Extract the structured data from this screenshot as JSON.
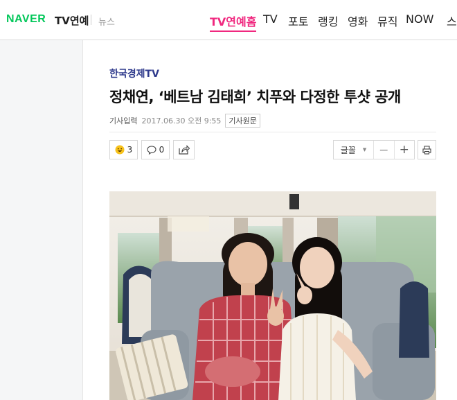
{
  "header": {
    "logo": "NAVER",
    "brand": "TV연예",
    "section": "뉴스",
    "nav": [
      {
        "label": "TV연예홈",
        "active": true
      },
      {
        "label": "TV",
        "active": false
      },
      {
        "label": "포토",
        "active": false
      },
      {
        "label": "랭킹",
        "active": false
      },
      {
        "label": "영화",
        "active": false
      },
      {
        "label": "뮤직",
        "active": false
      },
      {
        "label": "NOW",
        "active": false
      },
      {
        "label": "스",
        "active": false
      }
    ]
  },
  "article": {
    "press": "한국경제TV",
    "title": "정채연, ‘베트남 김태희’ 치푸와 다정한 투샷 공개",
    "date_label": "기사입력",
    "date": "2017.06.30 오전 9:55",
    "original_label": "기사원문"
  },
  "toolbar": {
    "reaction_count": "3",
    "comment_count": "0",
    "font_label": "글꼴",
    "minus": "—",
    "plus": "+"
  },
  "colors": {
    "naver_green": "#03c75a",
    "active_pink": "#f0287f",
    "press_blue": "#2e3a8c"
  }
}
